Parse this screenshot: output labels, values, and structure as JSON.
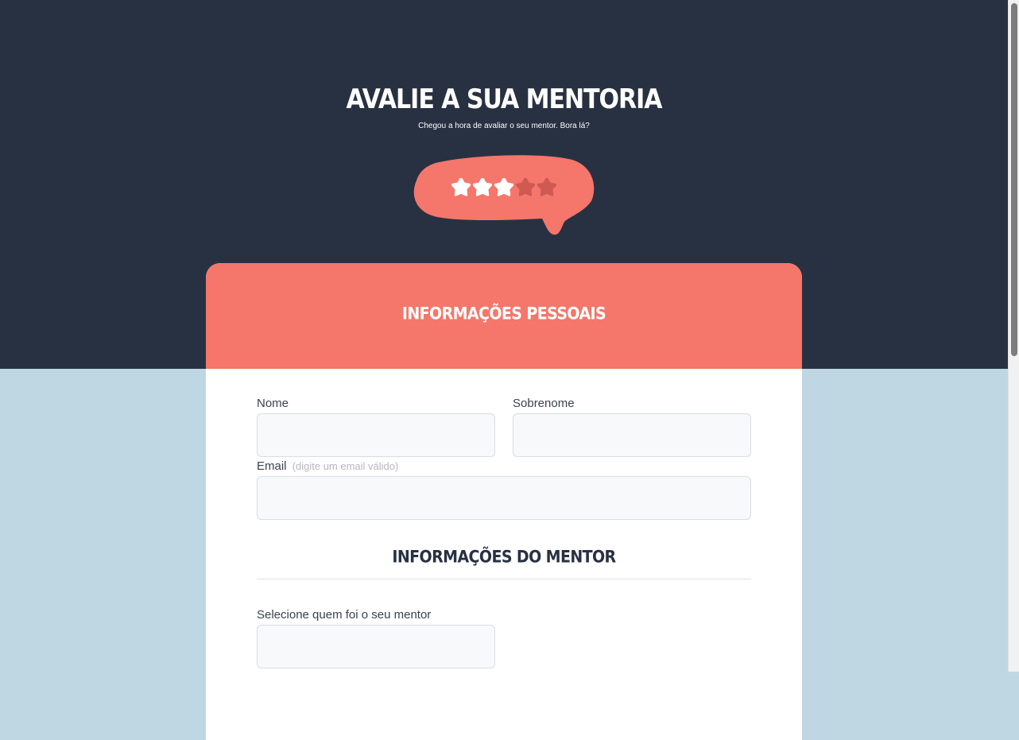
{
  "hero": {
    "title": "AVALIE A SUA MENTORIA",
    "subtitle": "Chegou a hora de avaliar o seu mentor. Bora lá?"
  },
  "rating": {
    "value": 3,
    "max": 5,
    "icon": "flower-star-icon"
  },
  "card": {
    "header_title": "INFORMAÇÕES PESSOAIS",
    "fields": {
      "nome": {
        "label": "Nome",
        "value": "",
        "placeholder": ""
      },
      "sobrenome": {
        "label": "Sobrenome",
        "value": "",
        "placeholder": ""
      },
      "email": {
        "label": "Email",
        "hint": "(digite um email válido)",
        "value": "",
        "placeholder": ""
      }
    },
    "mentor_section": {
      "title": "INFORMAÇÕES DO MENTOR",
      "select_label": "Selecione quem foi o seu mentor",
      "select_value": ""
    }
  },
  "colors": {
    "navy": "#283142",
    "coral": "#f5766a",
    "coral_dark": "#cf5a52",
    "light_blue": "#bfd7e3",
    "white": "#ffffff"
  }
}
